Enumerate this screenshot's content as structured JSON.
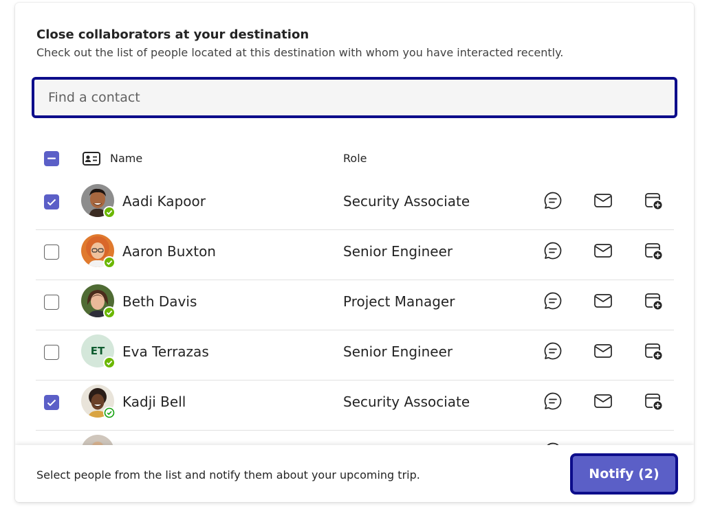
{
  "panel": {
    "title": "Close collaborators at your destination",
    "subtitle": "Check out the list of people located at this destination with whom you have interacted recently."
  },
  "search": {
    "placeholder": "Find a contact",
    "value": ""
  },
  "table": {
    "header": {
      "name": "Name",
      "role": "Role",
      "select_all_state": "mixed"
    },
    "rows": [
      {
        "name": "Aadi Kapoor",
        "role": "Security Associate",
        "checked": true,
        "avatar": "photo",
        "presence": "available"
      },
      {
        "name": "Aaron Buxton",
        "role": "Senior Engineer",
        "checked": false,
        "avatar": "photo",
        "presence": "available"
      },
      {
        "name": "Beth Davis",
        "role": "Project Manager",
        "checked": false,
        "avatar": "photo",
        "presence": "available"
      },
      {
        "name": "Eva Terrazas",
        "initials": "ET",
        "role": "Senior Engineer",
        "checked": false,
        "avatar": "initials",
        "presence": "available"
      },
      {
        "name": "Kadji Bell",
        "role": "Security Associate",
        "checked": true,
        "avatar": "photo",
        "presence": "available-outline"
      }
    ],
    "row_actions": [
      "chat-icon",
      "mail-icon",
      "calendar-add-icon"
    ]
  },
  "footer": {
    "text": "Select people from the list and notify them about your upcoming trip.",
    "notify_label": "Notify (2)"
  },
  "colors": {
    "accent": "#5b5fc7",
    "focus": "#0d0d8b",
    "presence": "#6bb700"
  }
}
